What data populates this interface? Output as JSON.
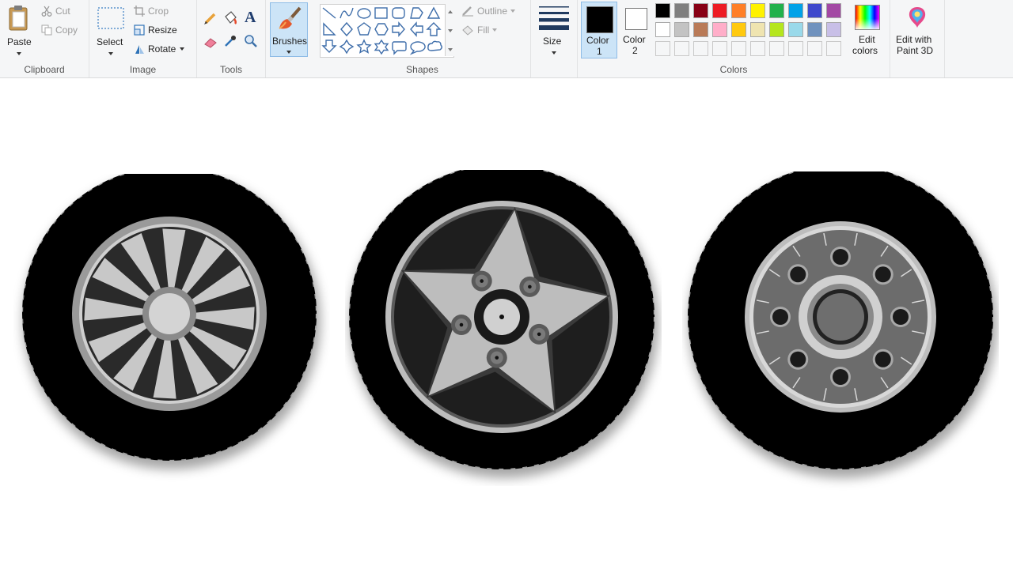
{
  "ribbon": {
    "clipboard": {
      "paste": "Paste",
      "cut": "Cut",
      "copy": "Copy",
      "group": "Clipboard"
    },
    "image": {
      "select": "Select",
      "crop": "Crop",
      "resize": "Resize",
      "rotate": "Rotate",
      "group": "Image"
    },
    "tools": {
      "group": "Tools",
      "text_glyph": "A"
    },
    "brushes": {
      "label": "Brushes"
    },
    "shapes": {
      "outline": "Outline",
      "fill": "Fill",
      "group": "Shapes"
    },
    "size": {
      "label": "Size"
    },
    "colors": {
      "color1_line1": "Color",
      "color1_line2": "1",
      "color2_line1": "Color",
      "color2_line2": "2",
      "edit_line1": "Edit",
      "edit_line2": "colors",
      "group": "Colors",
      "color1": "#000000",
      "color2": "#ffffff",
      "palette_row1": [
        "#000000",
        "#7f7f7f",
        "#880015",
        "#ed1c24",
        "#ff7f27",
        "#fff200",
        "#22b14c",
        "#00a2e8",
        "#3f48cc",
        "#a349a4"
      ],
      "palette_row2": [
        "#ffffff",
        "#c3c3c3",
        "#b97a57",
        "#ffaec9",
        "#ffc90e",
        "#efe4b0",
        "#b5e61d",
        "#99d9ea",
        "#7092be",
        "#c8bfe7"
      ],
      "palette_row3": [
        "",
        "",
        "",
        "",
        "",
        "",
        "",
        "",
        "",
        ""
      ]
    },
    "paint3d": {
      "line1": "Edit with",
      "line2": "Paint 3D"
    }
  },
  "canvas": {
    "wheels": [
      {
        "style": "spoke",
        "spoke_count": 12
      },
      {
        "style": "star",
        "spoke_count": 5
      },
      {
        "style": "lug",
        "lug_count": 8
      }
    ]
  }
}
